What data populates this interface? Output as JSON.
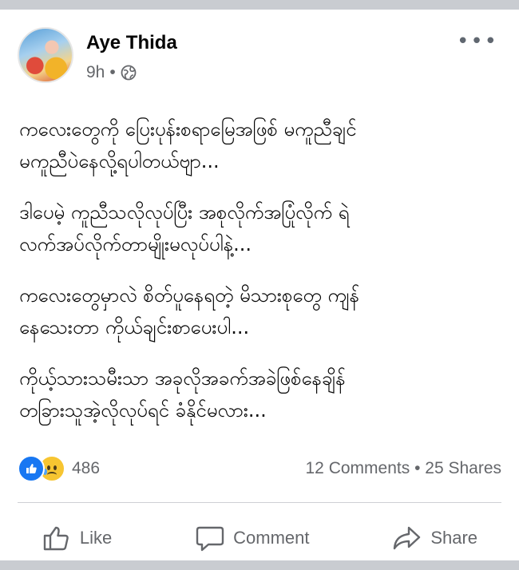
{
  "post": {
    "author": "Aye Thida",
    "time": "9h",
    "separator": "•",
    "more_glyph": "•••",
    "privacy_icon": "globe-icon",
    "paragraphs": [
      "ကလေးတွေကို ပြေးပုန်းစရာမြေအဖြစ် မကူညီချင်\nမကူညီပဲနေလို့ရပါတယ်ဗျာ...",
      "ဒါပေမဲ့ ကူညီသလိုလုပ်ပြီး အစုလိုက်အပြုံလိုက် ရဲ\nလက်အပ်လိုက်တာမျိုးမလုပ်ပါနဲ့...",
      "ကလေးတွေမှာလဲ စိတ်ပူနေရတဲ့ မိသားစုတွေ ကျန်\nနေသေးတာ ကိုယ်ချင်းစာပေးပါ...",
      "ကိုယ့်သားသမီးသာ အခုလိုအခက်အခဲဖြစ်နေချိန်\nတခြားသူအဲ့လိုလုပ်ရင် ခံနိုင်မလား..."
    ]
  },
  "stats": {
    "reaction_icons": [
      "like-icon",
      "sad-icon"
    ],
    "reaction_count": "486",
    "comments": "12 Comments",
    "dot": "•",
    "shares": "25 Shares"
  },
  "actions": {
    "like": "Like",
    "comment": "Comment",
    "share": "Share"
  },
  "colors": {
    "background": "#c9ccd1",
    "card": "#ffffff",
    "secondary_text": "#65676b",
    "like_blue": "#1877f2",
    "sad_yellow": "#f7c531"
  }
}
